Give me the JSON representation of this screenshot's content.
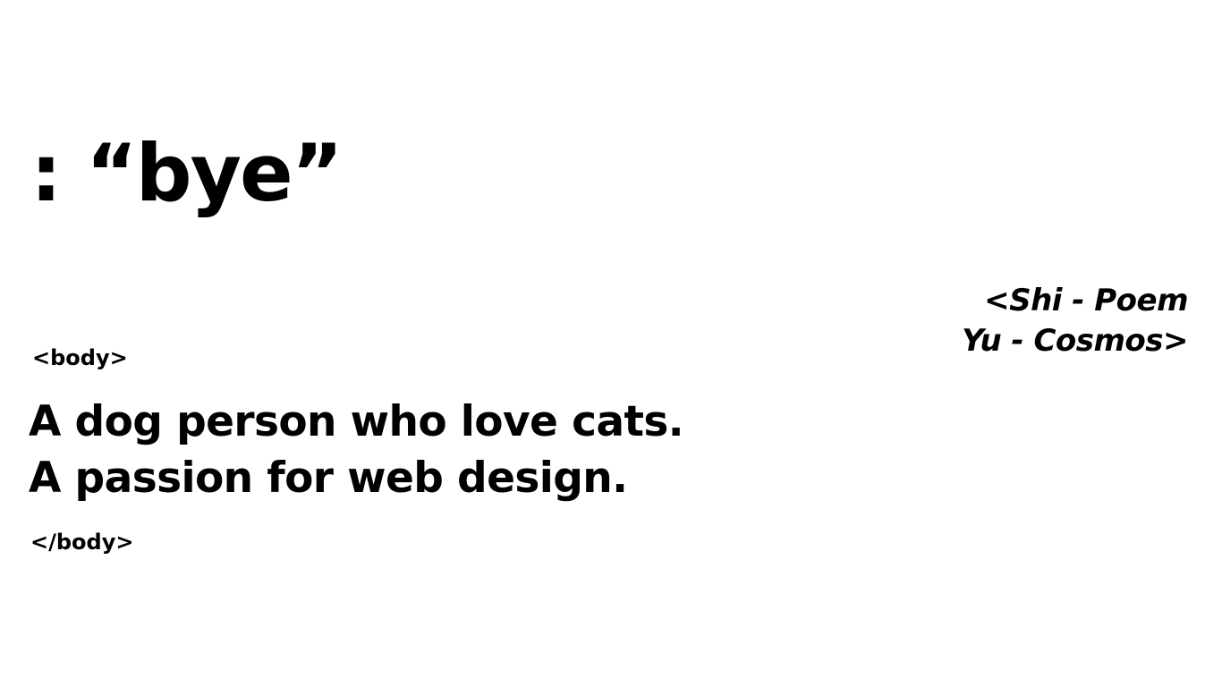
{
  "hero": {
    "text": ": “bye”"
  },
  "name_block": {
    "line1": "<Shi - Poem",
    "line2": "Yu - Cosmos>"
  },
  "body_tags": {
    "open": "<body>",
    "close": "</body>"
  },
  "bio": {
    "line1": "A dog person who love cats.",
    "line2": "A passion for web design."
  }
}
